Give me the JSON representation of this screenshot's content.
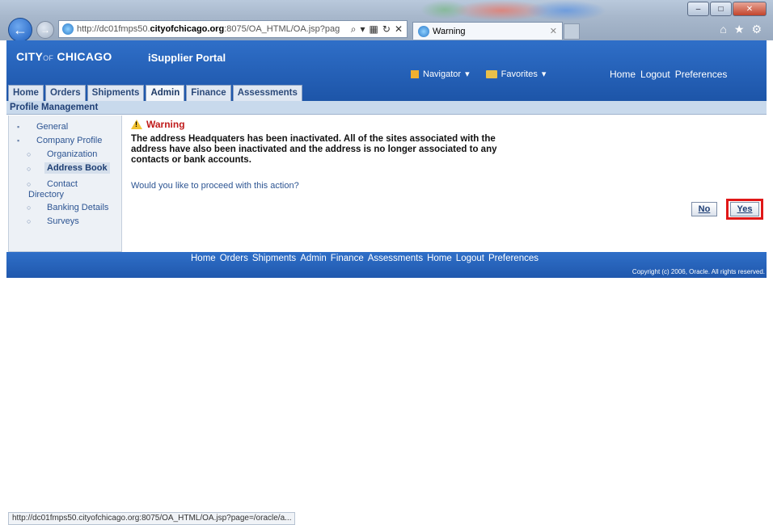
{
  "browser": {
    "url_prefix": "http://dc01fmps50.",
    "url_domain": "cityofchicago.org",
    "url_suffix": ":8075/OA_HTML/OA.jsp?pag",
    "tab_title": "Warning",
    "status_url": "http://dc01fmps50.cityofchicago.org:8075/OA_HTML/OA.jsp?page=/oracle/a..."
  },
  "header": {
    "logo_main": "CITY",
    "logo_of": "OF",
    "logo_city": "CHICAGO",
    "portal_title": "iSupplier Portal",
    "navigator": "Navigator",
    "favorites": "Favorites",
    "links": [
      "Home",
      "Logout",
      "Preferences"
    ]
  },
  "tabs": [
    {
      "label": "Home",
      "active": false
    },
    {
      "label": "Orders",
      "active": false
    },
    {
      "label": "Shipments",
      "active": false
    },
    {
      "label": "Admin",
      "active": true
    },
    {
      "label": "Finance",
      "active": false
    },
    {
      "label": "Assessments",
      "active": false
    }
  ],
  "subbar_title": "Profile Management",
  "sidebar": {
    "general": "General",
    "company_profile": "Company Profile",
    "organization": "Organization",
    "address_book": "Address Book",
    "contact": "Contact",
    "directory": "Directory",
    "banking_details": "Banking Details",
    "surveys": "Surveys"
  },
  "warning": {
    "title": "Warning",
    "line1": "The address Headquaters has been inactivated. All of the sites associated with the",
    "line2": "address have also been inactivated and the address is no longer associated to any",
    "line3": "contacts or bank accounts.",
    "question": "Would you like to proceed with this action?"
  },
  "buttons": {
    "no": "No",
    "yes": "Yes"
  },
  "footer": {
    "links": [
      "Home",
      "Orders",
      "Shipments",
      "Admin",
      "Finance",
      "Assessments",
      "Home",
      "Logout",
      "Preferences"
    ],
    "copyright": "Copyright (c) 2006, Oracle. All rights reserved."
  }
}
